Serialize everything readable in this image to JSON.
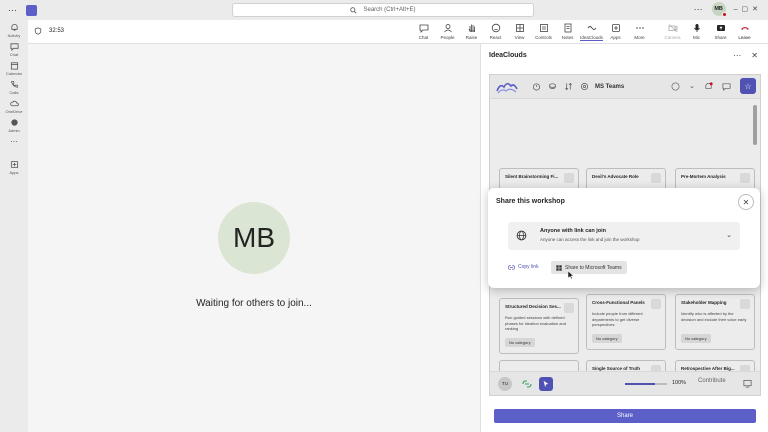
{
  "titlebar": {
    "search_placeholder": "Search (Ctrl+Alt+E)",
    "user_initials": "MB"
  },
  "rail": [
    {
      "label": "Activity",
      "icon": "bell-icon"
    },
    {
      "label": "Chat",
      "icon": "chat-icon"
    },
    {
      "label": "Calendar",
      "icon": "calendar-icon"
    },
    {
      "label": "Calls",
      "icon": "phone-icon"
    },
    {
      "label": "OneDrive",
      "icon": "cloud-icon"
    },
    {
      "label": "Admin",
      "icon": "admin-icon"
    },
    {
      "label": "Apps",
      "icon": "plus-box-icon"
    }
  ],
  "meeting": {
    "timer": "32:53",
    "tools": [
      {
        "label": "Chat",
        "icon": "chat-icon"
      },
      {
        "label": "People",
        "icon": "people-icon"
      },
      {
        "label": "Raise",
        "icon": "hand-icon"
      },
      {
        "label": "React",
        "icon": "smile-icon"
      },
      {
        "label": "View",
        "icon": "grid-icon"
      },
      {
        "label": "Controls",
        "icon": "controls-icon"
      },
      {
        "label": "Notes",
        "icon": "notes-icon"
      },
      {
        "label": "IdeaClouds",
        "icon": "ideaclouds-icon"
      },
      {
        "label": "Apps",
        "icon": "apps-icon"
      },
      {
        "label": "More",
        "icon": "more-icon"
      },
      {
        "label": "Camera",
        "icon": "camera-icon"
      },
      {
        "label": "Mic",
        "icon": "mic-icon"
      },
      {
        "label": "Share",
        "icon": "share-icon"
      },
      {
        "label": "Leave",
        "icon": "leave-icon"
      }
    ]
  },
  "stage": {
    "avatar_initials": "MB",
    "waiting_text": "Waiting for others to join..."
  },
  "panel": {
    "title": "IdeaClouds",
    "app_title": "MS Teams",
    "cards": [
      {
        "title": "Silent Brainstorming Fi...",
        "desc": "",
        "tag": ""
      },
      {
        "title": "Devil's Advocate Role",
        "desc": "",
        "tag": ""
      },
      {
        "title": "Pre-Mortem Analysis",
        "desc": "",
        "tag": ""
      },
      {
        "title": "Structured Decision Ses...",
        "desc": "Run guided sessions with defined phases for ideation evaluation and ranking",
        "tag": "No category"
      },
      {
        "title": "Cross-Functional Panels",
        "desc": "Include people from different departments to get diverse perspectives",
        "tag": "No category"
      },
      {
        "title": "Stakeholder Mapping",
        "desc": "Identify who is affected by the decision and include their voice early",
        "tag": "No category"
      },
      {
        "title": "",
        "desc": "",
        "tag": ""
      },
      {
        "title": "Single Source of Truth",
        "desc": "",
        "tag": ""
      },
      {
        "title": "Retrospective After Big...",
        "desc": "",
        "tag": ""
      }
    ],
    "bottom": {
      "user_initials": "TU",
      "zoom": "100%",
      "contribute": "Contribute"
    },
    "share_button": "Share"
  },
  "modal": {
    "title": "Share this workshop",
    "access_title": "Anyone with link can join",
    "access_sub": "Anyone can access the link and join the workshop",
    "copy_link": "Copy link",
    "share_teams": "Share to Microsoft Teams"
  }
}
